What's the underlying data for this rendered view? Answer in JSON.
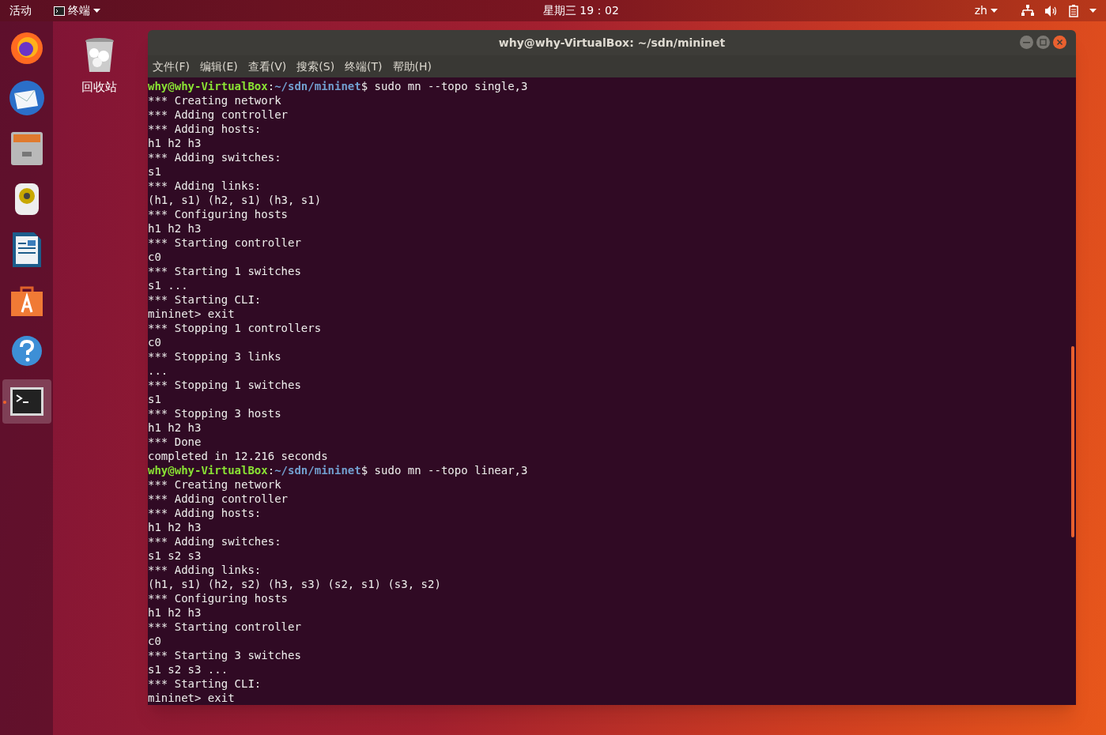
{
  "top_bar": {
    "activities": "活动",
    "app_menu": "终端",
    "clock": "星期三 19：02",
    "language": "zh"
  },
  "dock": [
    {
      "kind": "firefox",
      "selected": false,
      "running": false
    },
    {
      "kind": "mail",
      "selected": false,
      "running": false
    },
    {
      "kind": "files",
      "selected": false,
      "running": false
    },
    {
      "kind": "music",
      "selected": false,
      "running": false
    },
    {
      "kind": "writer",
      "selected": false,
      "running": false
    },
    {
      "kind": "store",
      "selected": false,
      "running": false
    },
    {
      "kind": "help",
      "selected": false,
      "running": false
    },
    {
      "kind": "terminal",
      "selected": true,
      "running": true
    }
  ],
  "desktop": {
    "trash_label": "回收站"
  },
  "window": {
    "title": "why@why-VirtualBox: ~/sdn/mininet",
    "menu": [
      "文件(F)",
      "编辑(E)",
      "查看(V)",
      "搜索(S)",
      "终端(T)",
      "帮助(H)"
    ],
    "lines": [
      {
        "kind": "prompt",
        "user": "why@why-VirtualBox",
        "sep": ":",
        "path": "~/sdn/mininet",
        "command": "$ sudo mn --topo single,3"
      },
      {
        "kind": "output",
        "text": "*** Creating network"
      },
      {
        "kind": "output",
        "text": "*** Adding controller"
      },
      {
        "kind": "output",
        "text": "*** Adding hosts:"
      },
      {
        "kind": "output",
        "text": "h1 h2 h3"
      },
      {
        "kind": "output",
        "text": "*** Adding switches:"
      },
      {
        "kind": "output",
        "text": "s1"
      },
      {
        "kind": "output",
        "text": "*** Adding links:"
      },
      {
        "kind": "output",
        "text": "(h1, s1) (h2, s1) (h3, s1)"
      },
      {
        "kind": "output",
        "text": "*** Configuring hosts"
      },
      {
        "kind": "output",
        "text": "h1 h2 h3"
      },
      {
        "kind": "output",
        "text": "*** Starting controller"
      },
      {
        "kind": "output",
        "text": "c0"
      },
      {
        "kind": "output",
        "text": "*** Starting 1 switches"
      },
      {
        "kind": "output",
        "text": "s1 ..."
      },
      {
        "kind": "output",
        "text": "*** Starting CLI:"
      },
      {
        "kind": "output",
        "text": "mininet> exit"
      },
      {
        "kind": "output",
        "text": "*** Stopping 1 controllers"
      },
      {
        "kind": "output",
        "text": "c0"
      },
      {
        "kind": "output",
        "text": "*** Stopping 3 links"
      },
      {
        "kind": "output",
        "text": "..."
      },
      {
        "kind": "output",
        "text": "*** Stopping 1 switches"
      },
      {
        "kind": "output",
        "text": "s1"
      },
      {
        "kind": "output",
        "text": "*** Stopping 3 hosts"
      },
      {
        "kind": "output",
        "text": "h1 h2 h3"
      },
      {
        "kind": "output",
        "text": "*** Done"
      },
      {
        "kind": "output",
        "text": "completed in 12.216 seconds"
      },
      {
        "kind": "prompt",
        "user": "why@why-VirtualBox",
        "sep": ":",
        "path": "~/sdn/mininet",
        "command": "$ sudo mn --topo linear,3"
      },
      {
        "kind": "output",
        "text": "*** Creating network"
      },
      {
        "kind": "output",
        "text": "*** Adding controller"
      },
      {
        "kind": "output",
        "text": "*** Adding hosts:"
      },
      {
        "kind": "output",
        "text": "h1 h2 h3"
      },
      {
        "kind": "output",
        "text": "*** Adding switches:"
      },
      {
        "kind": "output",
        "text": "s1 s2 s3"
      },
      {
        "kind": "output",
        "text": "*** Adding links:"
      },
      {
        "kind": "output",
        "text": "(h1, s1) (h2, s2) (h3, s3) (s2, s1) (s3, s2)"
      },
      {
        "kind": "output",
        "text": "*** Configuring hosts"
      },
      {
        "kind": "output",
        "text": "h1 h2 h3"
      },
      {
        "kind": "output",
        "text": "*** Starting controller"
      },
      {
        "kind": "output",
        "text": "c0"
      },
      {
        "kind": "output",
        "text": "*** Starting 3 switches"
      },
      {
        "kind": "output",
        "text": "s1 s2 s3 ..."
      },
      {
        "kind": "output",
        "text": "*** Starting CLI:"
      },
      {
        "kind": "output",
        "text": "mininet> exit"
      }
    ]
  }
}
